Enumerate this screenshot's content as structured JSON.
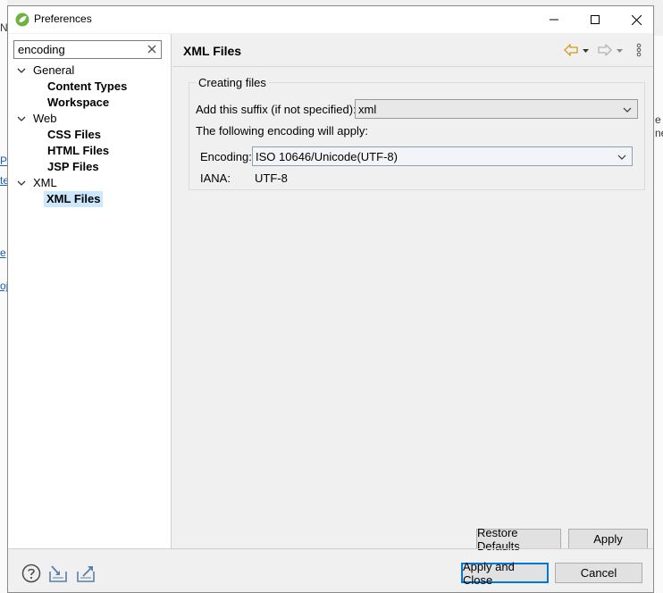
{
  "window": {
    "title": "Preferences"
  },
  "background": {
    "frag_a": "Na",
    "frag_b": "P",
    "frag_c": "te",
    "frag_d": "e",
    "frag_e": "oj",
    "frag_f": "e",
    "frag_g": "ne"
  },
  "filter": {
    "value": "encoding"
  },
  "tree": {
    "general": "General",
    "content_types": "Content Types",
    "workspace": "Workspace",
    "web": "Web",
    "css_files": "CSS Files",
    "html_files": "HTML Files",
    "jsp_files": "JSP Files",
    "xml": "XML",
    "xml_files": "XML Files"
  },
  "page": {
    "title": "XML Files",
    "group_title": "Creating files",
    "suffix_label": "Add this suffix (if not specified):",
    "suffix_value": "xml",
    "apply_text": "The following encoding will apply:",
    "encoding_label": "Encoding:",
    "encoding_value": "ISO 10646/Unicode(UTF-8)",
    "iana_label": "IANA:",
    "iana_value": "UTF-8"
  },
  "buttons": {
    "restore_defaults": "Restore Defaults",
    "apply": "Apply",
    "apply_and_close": "Apply and Close",
    "cancel": "Cancel"
  },
  "colors": {
    "selection": "#cce8ff",
    "default_button_border": "#0078d7",
    "back_arrow": "#e8b030"
  }
}
